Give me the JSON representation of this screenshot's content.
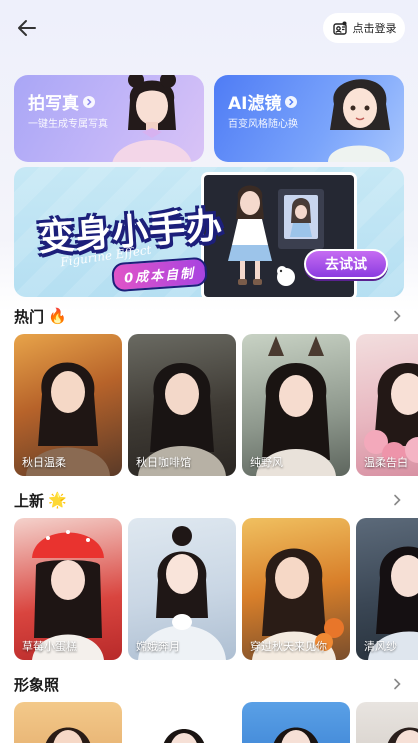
{
  "topbar": {
    "back_icon": "arrow-left-icon",
    "login_label": "点击登录",
    "login_icon": "user-id-icon"
  },
  "promos": [
    {
      "title": "拍写真",
      "subtitle": "一键生成专属写真",
      "color": "#a9a6f6"
    },
    {
      "title": "AI滤镜",
      "subtitle": "百变风格随心换",
      "color": "#4f7cf5"
    }
  ],
  "banner": {
    "title": "变身小手办",
    "script": "Figurine Effect",
    "tag": "0成本自制",
    "cta": "去试试"
  },
  "sections": [
    {
      "title": "热门",
      "emoji": "🔥",
      "cards": [
        {
          "label": "秋日温柔"
        },
        {
          "label": "秋日咖啡馆"
        },
        {
          "label": "纯野风"
        },
        {
          "label": "温柔告白"
        }
      ]
    },
    {
      "title": "上新",
      "emoji": "🌟",
      "cards": [
        {
          "label": "草莓小蛋糕"
        },
        {
          "label": "嫦娥奔月"
        },
        {
          "label": "穿过秋天来见你"
        },
        {
          "label": "清风纱"
        }
      ]
    },
    {
      "title": "形象照",
      "emoji": "",
      "cards": []
    }
  ]
}
